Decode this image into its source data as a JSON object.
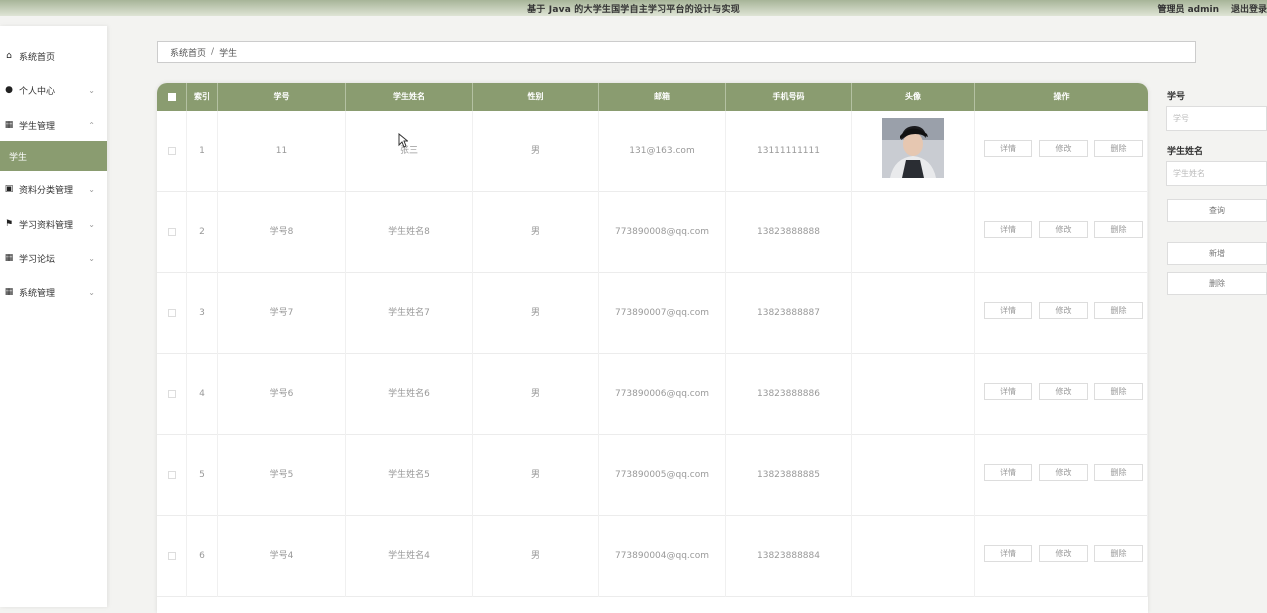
{
  "header": {
    "title": "基于 Java 的大学生国学自主学习平台的设计与实现",
    "user": "管理员 admin",
    "logout": "退出登录"
  },
  "sidebar": {
    "items": [
      {
        "label": "系统首页",
        "icon": "home-icon"
      },
      {
        "label": "个人中心",
        "icon": "user-icon"
      },
      {
        "label": "学生管理",
        "icon": "grid-icon"
      },
      {
        "label": "学生",
        "icon": ""
      },
      {
        "label": "资料分类管理",
        "icon": "briefcase-icon"
      },
      {
        "label": "学习资料管理",
        "icon": "flag-icon"
      },
      {
        "label": "学习论坛",
        "icon": "grid-icon"
      },
      {
        "label": "系统管理",
        "icon": "grid-icon"
      }
    ]
  },
  "breadcrumb": {
    "home": "系统首页",
    "sep": "/",
    "current": "学生"
  },
  "table": {
    "headers": [
      "索引",
      "学号",
      "学生姓名",
      "性别",
      "邮箱",
      "手机号码",
      "头像",
      "操作"
    ],
    "actions": {
      "detail": "详情",
      "edit": "修改",
      "delete": "删除"
    },
    "rows": [
      {
        "index": "1",
        "id": "11",
        "name": "张三",
        "gender": "男",
        "email": "131@163.com",
        "phone": "13111111111"
      },
      {
        "index": "2",
        "id": "学号8",
        "name": "学生姓名8",
        "gender": "男",
        "email": "773890008@qq.com",
        "phone": "13823888888"
      },
      {
        "index": "3",
        "id": "学号7",
        "name": "学生姓名7",
        "gender": "男",
        "email": "773890007@qq.com",
        "phone": "13823888887"
      },
      {
        "index": "4",
        "id": "学号6",
        "name": "学生姓名6",
        "gender": "男",
        "email": "773890006@qq.com",
        "phone": "13823888886"
      },
      {
        "index": "5",
        "id": "学号5",
        "name": "学生姓名5",
        "gender": "男",
        "email": "773890005@qq.com",
        "phone": "13823888885"
      },
      {
        "index": "6",
        "id": "学号4",
        "name": "学生姓名4",
        "gender": "男",
        "email": "773890004@qq.com",
        "phone": "13823888884"
      }
    ]
  },
  "search": {
    "id_label": "学号",
    "id_placeholder": "学号",
    "name_label": "学生姓名",
    "name_placeholder": "学生姓名",
    "query": "查询",
    "add": "新增",
    "delete": "删除"
  },
  "colors": {
    "accent": "#8a9c70"
  }
}
